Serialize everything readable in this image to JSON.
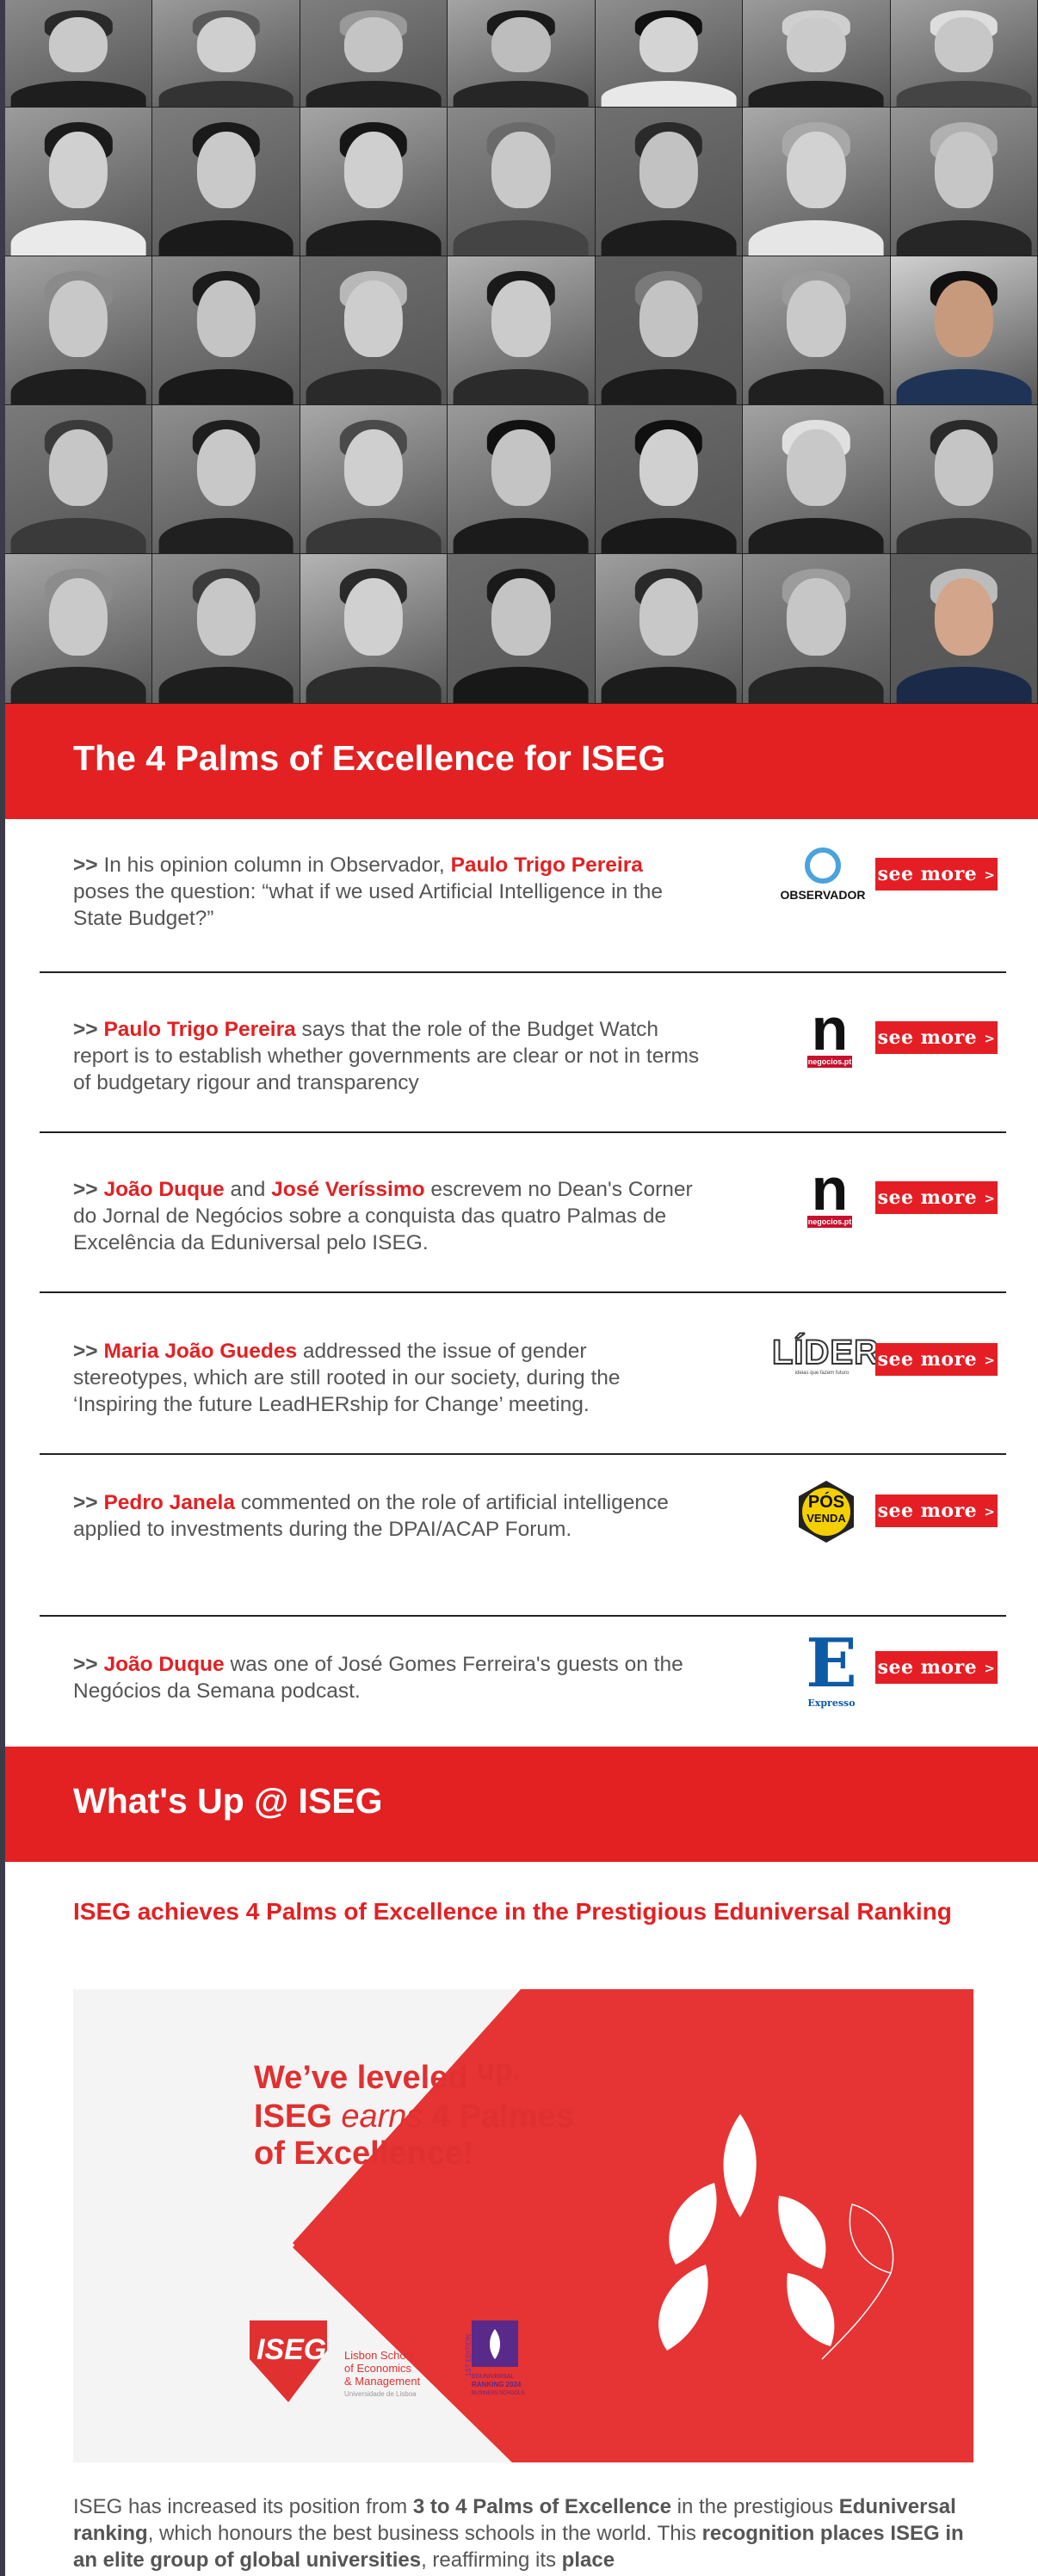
{
  "photos": {
    "rows": [
      [
        {
          "bg": "#8a8a8a",
          "skin": "#c9c9c9",
          "hair": "#2a2a2a",
          "suit": "#1e1e1e"
        },
        {
          "bg": "#9a9a9a",
          "skin": "#cfcfcf",
          "hair": "#5a5a5a",
          "suit": "#333"
        },
        {
          "bg": "#7e7e7e",
          "skin": "#c4c4c4",
          "hair": "#999",
          "suit": "#222"
        },
        {
          "bg": "#a4a4a4",
          "skin": "#bdbdbd",
          "hair": "#1a1a1a",
          "suit": "#262626"
        },
        {
          "bg": "#8e8e8e",
          "skin": "#d4d4d4",
          "hair": "#111",
          "suit": "#e8e8e8"
        },
        {
          "bg": "#9b9b9b",
          "skin": "#cacaca",
          "hair": "#cfcfcf",
          "suit": "#1f1f1f"
        },
        {
          "bg": "#a0a0a0",
          "skin": "#c7c7c7",
          "hair": "#ddd",
          "suit": "#444"
        }
      ],
      [
        {
          "bg": "#9c9c9c",
          "skin": "#d0d0d0",
          "hair": "#1b1b1b",
          "suit": "#eaeaea"
        },
        {
          "bg": "#7c7c7c",
          "skin": "#c9c9c9",
          "hair": "#1a1a1a",
          "suit": "#1a1a1a"
        },
        {
          "bg": "#a5a5a5",
          "skin": "#cfcfcf",
          "hair": "#161616",
          "suit": "#1d1d1d"
        },
        {
          "bg": "#888",
          "skin": "#c8c8c8",
          "hair": "#6a6a6a",
          "suit": "#444"
        },
        {
          "bg": "#6f6f6f",
          "skin": "#c2c2c2",
          "hair": "#2a2a2a",
          "suit": "#1c1c1c"
        },
        {
          "bg": "#a9a9a9",
          "skin": "#d2d2d2",
          "hair": "#a8a8a8",
          "suit": "#e6e6e6"
        },
        {
          "bg": "#959595",
          "skin": "#c6c6c6",
          "hair": "#b0b0b0",
          "suit": "#262626"
        }
      ],
      [
        {
          "bg": "#a3a3a3",
          "skin": "#c8c8c8",
          "hair": "#8a8a8a",
          "suit": "#1e1e1e"
        },
        {
          "bg": "#8a8a8a",
          "skin": "#c4c4c4",
          "hair": "#1b1b1b",
          "suit": "#1a1a1a"
        },
        {
          "bg": "#6f6f6f",
          "skin": "#cdcdcd",
          "hair": "#b8b8b8",
          "suit": "#2a2a2a"
        },
        {
          "bg": "#b0b0b0",
          "skin": "#cbcbcb",
          "hair": "#1a1a1a",
          "suit": "#2b2b2b"
        },
        {
          "bg": "#5f5f5f",
          "skin": "#c3c3c3",
          "hair": "#7a7a7a",
          "suit": "#1c1c1c"
        },
        {
          "bg": "#a6a6a6",
          "skin": "#c9c9c9",
          "hair": "#9a9a9a",
          "suit": "#202020"
        },
        {
          "bg": "#d0d0d0",
          "skin": "#c89a7d",
          "hair": "#111",
          "suit": "#1f3356"
        }
      ],
      [
        {
          "bg": "#7a7a7a",
          "skin": "#c6c6c6",
          "hair": "#3a3a3a",
          "suit": "#3a3a3a"
        },
        {
          "bg": "#8f8f8f",
          "skin": "#c8c8c8",
          "hair": "#1e1e1e",
          "suit": "#202020"
        },
        {
          "bg": "#a8a8a8",
          "skin": "#cfcfcf",
          "hair": "#4a4a4a",
          "suit": "#383838"
        },
        {
          "bg": "#9a9a9a",
          "skin": "#c4c4c4",
          "hair": "#111",
          "suit": "#1b1b1b"
        },
        {
          "bg": "#6a6a6a",
          "skin": "#d0d0d0",
          "hair": "#101010",
          "suit": "#191919"
        },
        {
          "bg": "#a2a2a2",
          "skin": "#c8c8c8",
          "hair": "#e0e0e0",
          "suit": "#1d1d1d"
        },
        {
          "bg": "#979797",
          "skin": "#c5c5c5",
          "hair": "#2a2a2a",
          "suit": "#333"
        }
      ],
      [
        {
          "bg": "#a7a7a7",
          "skin": "#c9c9c9",
          "hair": "#8c8c8c",
          "suit": "#232323"
        },
        {
          "bg": "#8d8d8d",
          "skin": "#c7c7c7",
          "hair": "#3c3c3c",
          "suit": "#1e1e1e"
        },
        {
          "bg": "#b4b4b4",
          "skin": "#d0d0d0",
          "hair": "#2a2a2a",
          "suit": "#2d2d2d"
        },
        {
          "bg": "#6c6c6c",
          "skin": "#c4c4c4",
          "hair": "#1a1a1a",
          "suit": "#181818"
        },
        {
          "bg": "#9e9e9e",
          "skin": "#c8c8c8",
          "hair": "#2a2a2a",
          "suit": "#1c1c1c"
        },
        {
          "bg": "#8b8b8b",
          "skin": "#c6c6c6",
          "hair": "#9c9c9c",
          "suit": "#262626"
        },
        {
          "bg": "#5e5e5e",
          "skin": "#d3a58a",
          "hair": "#bcbcbc",
          "suit": "#1a2a48"
        }
      ]
    ]
  },
  "section1": {
    "title": "The 4 Palms of Excellence for ISEG"
  },
  "news": [
    {
      "parts": [
        {
          "t": ">> ",
          "cls": "arr"
        },
        {
          "t": "In his opinion column in Observador, ",
          "cls": ""
        },
        {
          "t": "Paulo Trigo Pereira",
          "cls": "nm"
        },
        {
          "t": " poses the question: “what if we used Artificial Intelligence in the State Budget?”",
          "cls": ""
        }
      ],
      "logo": "observador",
      "logo_text": "OBSERVADOR",
      "button": "see more",
      "button_arrow": ">"
    },
    {
      "parts": [
        {
          "t": ">> ",
          "cls": "arr"
        },
        {
          "t": "Paulo Trigo Pereira",
          "cls": "nm"
        },
        {
          "t": " says that the role of the Budget Watch report is to establish whether governments are clear or not in terms of budgetary rigour and transparency",
          "cls": ""
        }
      ],
      "logo": "negocios",
      "logo_letter": "n",
      "logo_text": "negocios.pt",
      "button": "see more",
      "button_arrow": ">"
    },
    {
      "parts": [
        {
          "t": ">> ",
          "cls": "arr"
        },
        {
          "t": "João Duque",
          "cls": "nm"
        },
        {
          "t": " and ",
          "cls": ""
        },
        {
          "t": "José Veríssimo",
          "cls": "nm"
        },
        {
          "t": " escrevem no Dean's Corner do Jornal de Negócios sobre a conquista das quatro Palmas de Excelência da Eduniversal pelo ISEG.",
          "cls": ""
        }
      ],
      "logo": "negocios",
      "logo_letter": "n",
      "logo_text": "negocios.pt",
      "button": "see more",
      "button_arrow": ">"
    },
    {
      "parts": [
        {
          "t": ">> ",
          "cls": "arr"
        },
        {
          "t": "Maria João Guedes",
          "cls": "nm"
        },
        {
          "t": " addressed the issue of gender stereotypes, which are still rooted in our society, during the ‘Inspiring the future LeadHERship for Change’ meeting.",
          "cls": ""
        }
      ],
      "logo": "lider",
      "logo_text": "LÍDER",
      "logo_sub": "ideias que fazem futuro",
      "button": "see more",
      "button_arrow": ">"
    },
    {
      "parts": [
        {
          "t": ">> ",
          "cls": "arr"
        },
        {
          "t": "Pedro Janela",
          "cls": "nm"
        },
        {
          "t": " commented on the role of artificial intelligence applied to investments during the DPAI/ACAP Forum.",
          "cls": ""
        }
      ],
      "logo": "posvenda",
      "logo_text": "PÓS",
      "logo_text2": "VENDA",
      "button": "see more",
      "button_arrow": ">"
    },
    {
      "parts": [
        {
          "t": ">> ",
          "cls": "arr"
        },
        {
          "t": "João Duque",
          "cls": "nm"
        },
        {
          "t": " was one of José Gomes Ferreira's guests on the Negócios da Semana podcast.",
          "cls": ""
        }
      ],
      "logo": "expresso",
      "logo_letter": "E",
      "logo_text": "Expresso",
      "button": "see more",
      "button_arrow": ">"
    }
  ],
  "section2": {
    "title": "What's Up @ ISEG"
  },
  "article": {
    "title": "ISEG achieves 4 Palms of Excellence in the Prestigious Eduniversal Ranking",
    "hero": {
      "line1a": "We’ve leveled ",
      "line1b": "up.",
      "line2a": "ISEG ",
      "line2b": "earns",
      "line2c": " 4 Palmes",
      "line3": "of Excellence!",
      "logo_iseg": "ISEG",
      "logo_l1": "Lisbon School",
      "logo_l2": "of Economics",
      "logo_l3": "& Management",
      "logo_l4": "Universidade de Lisboa",
      "edu_edition": "1ST EDITION",
      "edu_l1": "EDUNIVERSAL",
      "edu_l2": "RANKING 2024",
      "edu_l3": "BUSINESS SCHOOLS"
    },
    "body": [
      {
        "t": "ISEG has increased its position from ",
        "b": false
      },
      {
        "t": "3 to 4 Palms of Excellence",
        "b": true
      },
      {
        "t": " in the prestigious ",
        "b": false
      },
      {
        "t": "Eduniversal ranking",
        "b": true
      },
      {
        "t": ", which honours the best business schools in the world. This ",
        "b": false
      },
      {
        "t": "recognition places ISEG in an elite group of global universities",
        "b": true
      },
      {
        "t": ", reaffirming its ",
        "b": false
      },
      {
        "t": "place",
        "b": true
      }
    ]
  }
}
